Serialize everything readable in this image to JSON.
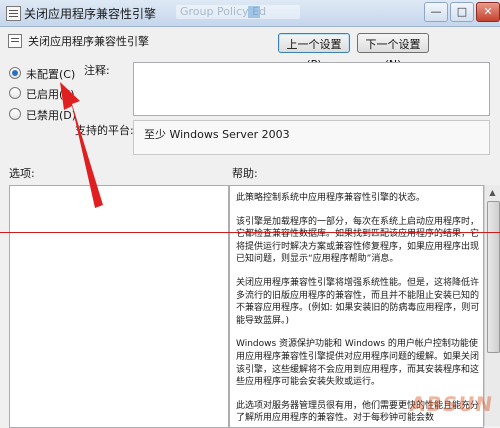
{
  "window": {
    "title": "关闭应用程序兼容性引擎",
    "ghost_title": "Group Policy Ed"
  },
  "header": {
    "policy_name": "关闭应用程序兼容性引擎",
    "prev_button": "上一个设置(P)",
    "next_button": "下一个设置(N)"
  },
  "state": {
    "options": [
      "未配置(C)",
      "已启用(E)",
      "已禁用(D)"
    ],
    "selected": 0
  },
  "comment": {
    "label": "注释:",
    "value": ""
  },
  "platform": {
    "label": "支持的平台:",
    "value": "至少 Windows Server 2003"
  },
  "options_section": {
    "label": "选项:"
  },
  "help_section": {
    "label": "帮助:",
    "paragraphs": [
      "此策略控制系统中应用程序兼容性引擎的状态。",
      "该引擎是加载程序的一部分，每次在系统上启动应用程序时，它都检查兼容性数据库。如果找到匹配该应用程序的结果，它将提供运行时解决方案或兼容性修复程序，如果应用程序出现已知问题，则显示“应用程序帮助”消息。",
      "关闭应用程序兼容性引擎将增强系统性能。但是，这将降低许多流行的旧版应用程序的兼容性，而且并不能阻止安装已知的不兼容应用程序。(例如: 如果安装旧的防病毒应用程序，则可能导致蓝屏。)",
      "Windows 资源保护功能和 Windows 的用户帐户控制功能使用应用程序兼容性引擎提供对应用程序问题的缓解。如果关闭该引擎，这些缓解将不会应用到应用程序，而其安装程序和这些应用程序可能会安装失败或运行。",
      "此选项对服务器管理员很有用，他们需要更快的性能且能充分了解所用应用程序的兼容性。对于每秒钟可能会数"
    ]
  },
  "watermark": "ABSUN"
}
